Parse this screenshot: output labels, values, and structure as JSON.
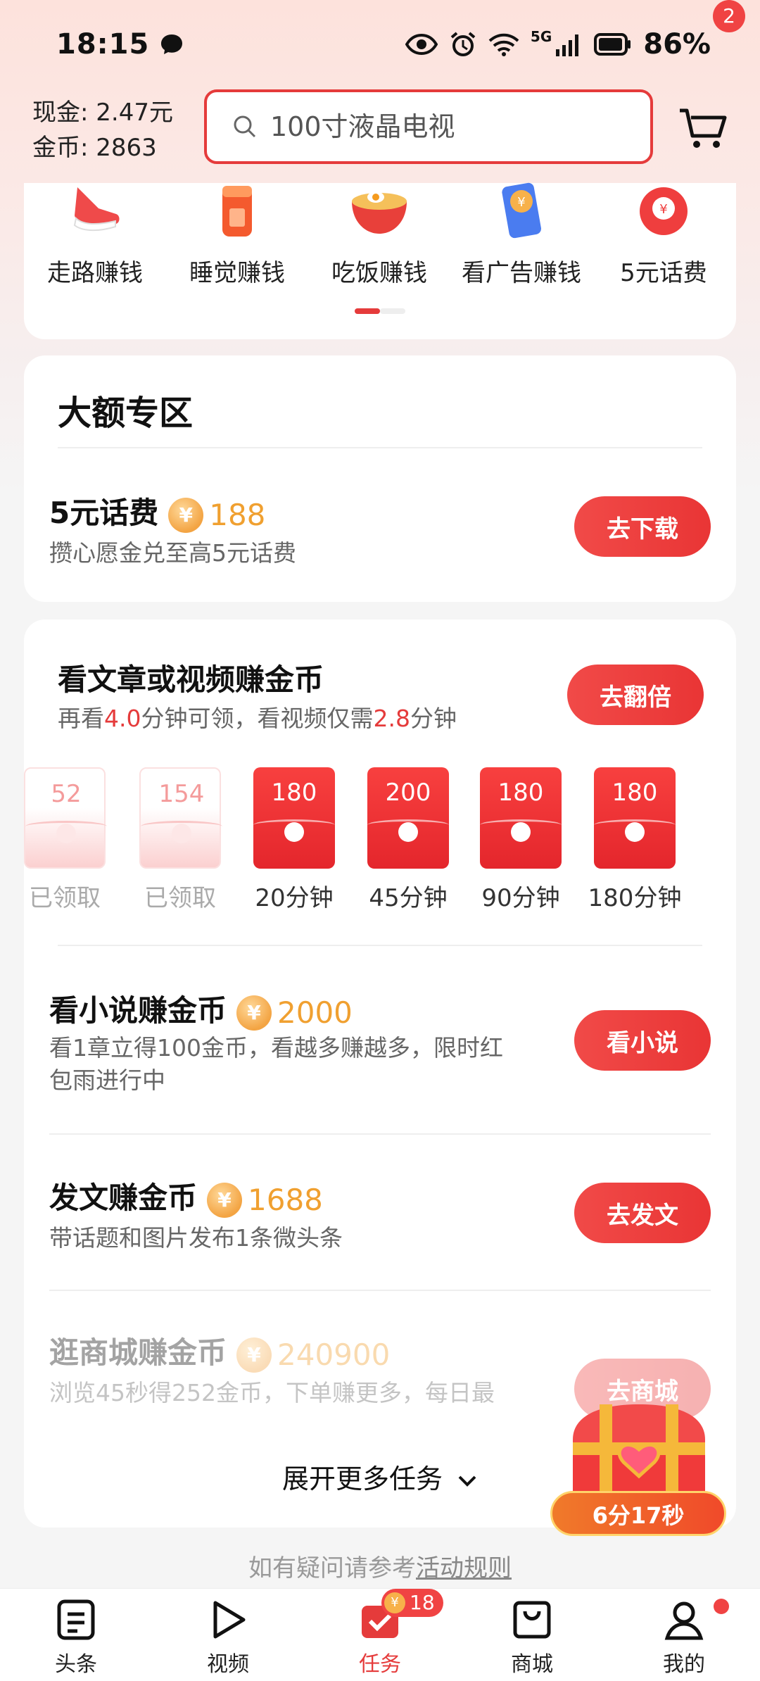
{
  "status_bar": {
    "time": "18:15",
    "network": "5G",
    "battery": "86%"
  },
  "header": {
    "cash_label": "现金: 2.47元",
    "gold_label": "金币: 2863",
    "search_placeholder": "100寸液晶电视",
    "cart_badge": "2"
  },
  "earn_ways": {
    "items": [
      {
        "label": "走路赚钱",
        "icon": "sneaker-icon"
      },
      {
        "label": "睡觉赚钱",
        "icon": "bottle-icon"
      },
      {
        "label": "吃饭赚钱",
        "icon": "noodle-bowl-icon"
      },
      {
        "label": "看广告赚钱",
        "icon": "phone-coin-icon"
      },
      {
        "label": "5元话费",
        "icon": "red-coin-bag-icon"
      }
    ]
  },
  "big_zone": {
    "title": "大额专区",
    "task": {
      "title": "5元话费",
      "coins": "188",
      "desc": "攒心愿金兑至高5元话费",
      "button": "去下载"
    }
  },
  "article_task": {
    "title": "看文章或视频赚金币",
    "desc_prefix": "再看",
    "desc_minutes1": "4.0",
    "desc_mid": "分钟可领，看视频仅需",
    "desc_minutes2": "2.8",
    "desc_suffix": "分钟",
    "button": "去翻倍",
    "envelopes": [
      {
        "amount": "52",
        "label": "已领取",
        "state": "claimed"
      },
      {
        "amount": "154",
        "label": "已领取",
        "state": "claimed"
      },
      {
        "amount": "180",
        "label": "20分钟",
        "state": "open"
      },
      {
        "amount": "200",
        "label": "45分钟",
        "state": "open"
      },
      {
        "amount": "180",
        "label": "90分钟",
        "state": "open"
      },
      {
        "amount": "180",
        "label": "180分钟",
        "state": "open"
      }
    ]
  },
  "tasks": [
    {
      "title": "看小说赚金币",
      "coins": "2000",
      "desc_line1": "看1章立得100金币，看越多赚越多，限时红",
      "desc_line2": "包雨进行中",
      "button": "看小说"
    },
    {
      "title": "发文赚金币",
      "coins": "1688",
      "desc_line1": "带话题和图片发布1条微头条",
      "button": "去发文"
    },
    {
      "title": "逛商城赚金币",
      "coins": "240900",
      "desc_line1": "浏览45秒得252金币，下单赚更多，每日最",
      "button": "去商城"
    }
  ],
  "expand_label": "展开更多任务",
  "chest_timer": "6分17秒",
  "rules_note": {
    "prefix": "如有疑问请参考",
    "link": "活动规则"
  },
  "tabbar": [
    {
      "label": "头条",
      "icon": "news-icon"
    },
    {
      "label": "视频",
      "icon": "play-icon"
    },
    {
      "label": "任务",
      "icon": "task-check-icon",
      "badge": "18"
    },
    {
      "label": "商城",
      "icon": "shopping-bag-icon"
    },
    {
      "label": "我的",
      "icon": "profile-icon"
    }
  ],
  "colors": {
    "accent": "#e53b3b",
    "coin": "#f0a030"
  }
}
